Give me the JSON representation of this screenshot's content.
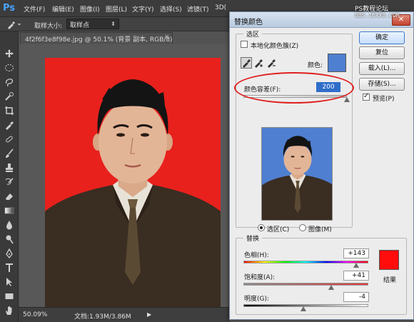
{
  "app": {
    "logo": "Ps",
    "menu": [
      "文件(F)",
      "编辑(E)",
      "图像(I)",
      "图层(L)",
      "文字(Y)",
      "选择(S)",
      "滤镜(T)",
      "3D("
    ]
  },
  "options_bar": {
    "sample_label": "取样大小:",
    "sample_value": "取样点"
  },
  "document": {
    "tab_title": "4f2f6f3e8f98e.jpg @ 50.1% (背景 副本, RGB/8) *",
    "tab_close": "×",
    "zoom": "50.09%",
    "doc_size": "文档:1.93M/3.86M",
    "background_color": "#e8211d"
  },
  "watermark": {
    "line1": "PS教程论坛",
    "line2": "BBS.16XX8.COM"
  },
  "dialog": {
    "title": "替换颜色",
    "close": "✕",
    "selection": {
      "group_title": "选区",
      "localized_label": "本地化颜色簇(Z)",
      "localized_checked": false,
      "color_label": "颜色:",
      "color": "#4f7fd1",
      "fuzziness_label": "颜色容差(F):",
      "fuzziness_value": "200",
      "fuzziness_fraction": 1.0,
      "view_selection_label": "选区(C)",
      "view_image_label": "图像(M)",
      "view_mode": "selection"
    },
    "buttons": {
      "ok": "确定",
      "reset": "复位",
      "load": "载入(L)...",
      "save": "存储(S)...",
      "preview_label": "预览(P)",
      "preview_checked": true
    },
    "replacement": {
      "group_title": "替换",
      "hue_label": "色相(H):",
      "hue_value": "+143",
      "hue_fraction": 0.9,
      "saturation_label": "饱和度(A):",
      "saturation_value": "+41",
      "saturation_fraction": 0.7,
      "lightness_label": "明度(G):",
      "lightness_value": "-4",
      "lightness_fraction": 0.48,
      "result_label": "结果",
      "result_color": "#ff0d0d"
    },
    "preview_background": "#4f7fd1"
  }
}
